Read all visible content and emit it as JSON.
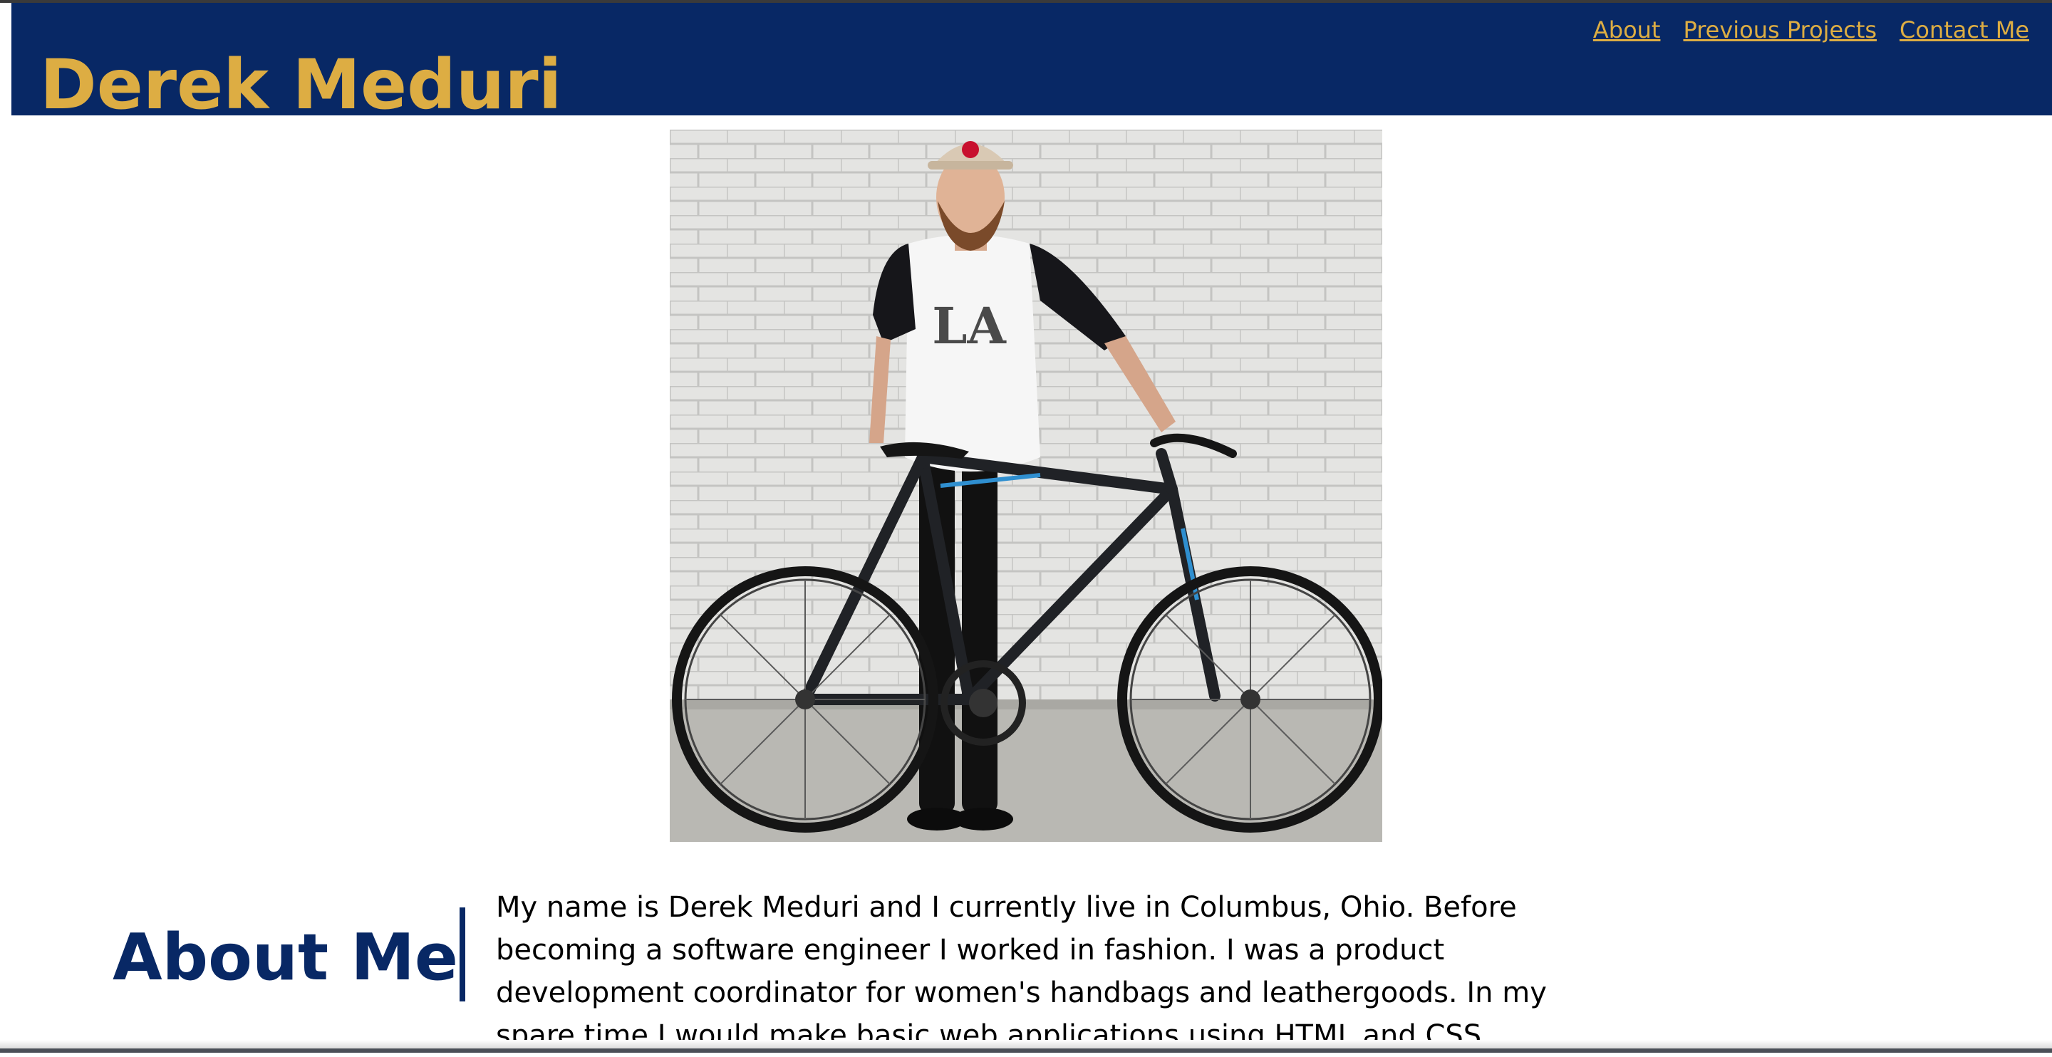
{
  "header": {
    "title": "Derek Meduri",
    "nav": {
      "about": "About",
      "previous_projects": "Previous Projects",
      "contact": "Contact Me"
    }
  },
  "colors": {
    "header_bg": "#082865",
    "accent_gold": "#ddad43",
    "heading_navy": "#082865"
  },
  "about": {
    "heading": "About Me",
    "text": "My name is Derek Meduri and I currently live in Columbus, Ohio. Before becoming a software engineer I worked in fashion. I was a product development coordinator for women's handbags and leathergoods. In my spare time I would make basic web applications using HTML and CSS."
  }
}
